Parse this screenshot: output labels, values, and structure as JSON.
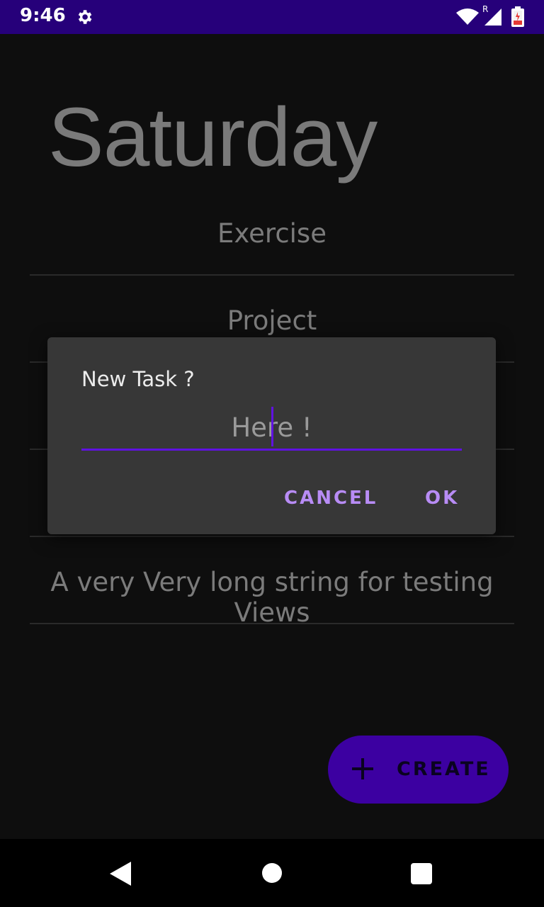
{
  "status_bar": {
    "time": "9:46",
    "settings_icon": "gear-icon",
    "wifi_icon": "wifi-icon",
    "roaming_label": "R",
    "signal_icon": "cell-signal-icon",
    "battery_icon": "battery-low-icon",
    "background_color": "#26007a"
  },
  "main": {
    "day_title": "Saturday",
    "tasks": [
      {
        "label": "Exercise"
      },
      {
        "label": "Project"
      },
      {
        "label": ""
      },
      {
        "label": ""
      },
      {
        "label": "A very Very long string for testing Views"
      }
    ]
  },
  "fab": {
    "icon": "plus-icon",
    "label": "CREATE",
    "color": "#3c00a1"
  },
  "dialog": {
    "title": "New Task ?",
    "input": {
      "value": "",
      "placeholder": "Here !"
    },
    "cancel_label": "CANCEL",
    "ok_label": "OK",
    "accent_color": "#b88cf5",
    "underline_color": "#5f12e0"
  },
  "nav_bar": {
    "back_icon": "back-triangle-icon",
    "home_icon": "home-circle-icon",
    "recents_icon": "recents-square-icon"
  }
}
